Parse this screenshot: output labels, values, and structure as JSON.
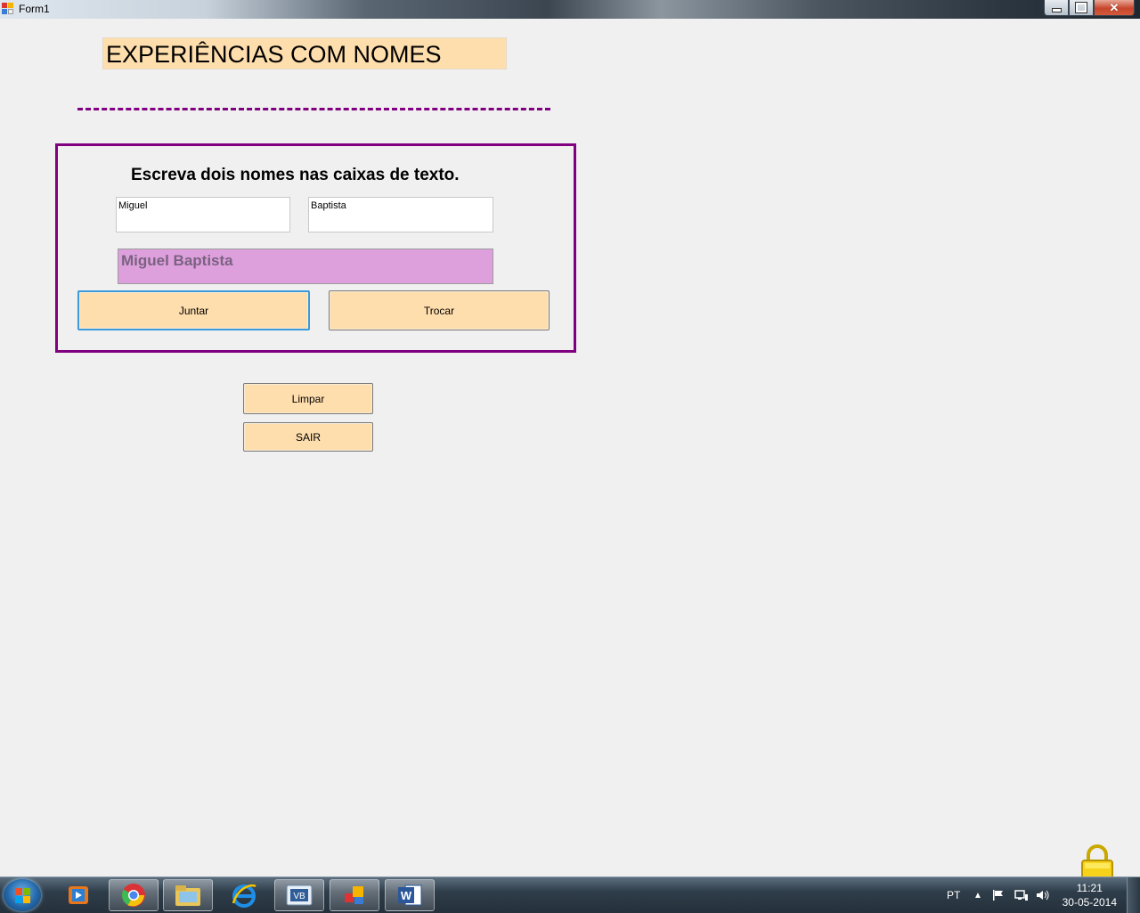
{
  "window": {
    "title": "Form1"
  },
  "form": {
    "heading": "EXPERIÊNCIAS COM NOMES",
    "instructions": "Escreva dois nomes nas caixas de texto.",
    "first_name_value": "Miguel",
    "last_name_value": "Baptista",
    "result_text": "Miguel Baptista",
    "join_button": "Juntar",
    "swap_button": "Trocar",
    "clear_button": "Limpar",
    "exit_button": "SAIR"
  },
  "colors": {
    "accent_purple": "#800080",
    "label_background": "#ffdead",
    "result_background": "#dda0dd"
  },
  "taskbar": {
    "pinned": [
      "windows-start-icon",
      "media-player-icon",
      "chrome-icon",
      "windows-explorer-icon",
      "internet-explorer-icon",
      "visual-basic-icon",
      "form-app-icon",
      "word-icon"
    ],
    "language": "PT",
    "time": "11:21",
    "date": "30-05-2014"
  }
}
